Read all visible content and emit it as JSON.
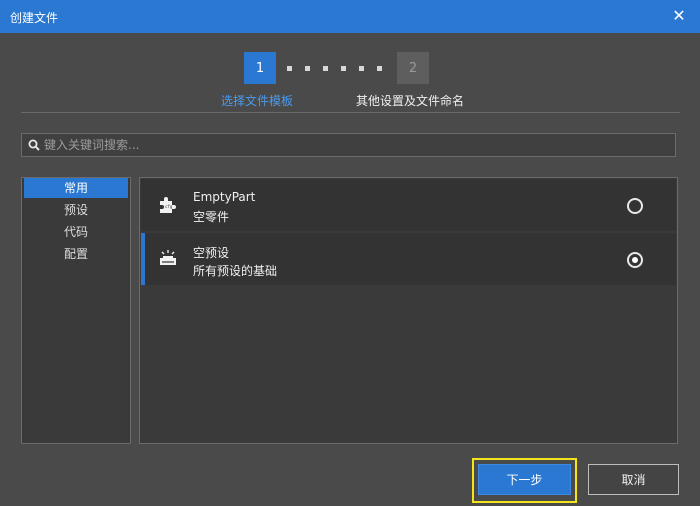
{
  "window": {
    "title": "创建文件",
    "close_icon": "close-icon"
  },
  "stepper": {
    "steps": [
      {
        "number": "1",
        "label": "选择文件模板",
        "state": "active"
      },
      {
        "number": "2",
        "label": "其他设置及文件命名",
        "state": "inactive"
      }
    ]
  },
  "search": {
    "placeholder": "键入关键词搜索...",
    "value": ""
  },
  "categories": [
    {
      "label": "常用",
      "active": true
    },
    {
      "label": "预设",
      "active": false
    },
    {
      "label": "代码",
      "active": false
    },
    {
      "label": "配置",
      "active": false
    }
  ],
  "templates": [
    {
      "name": "EmptyPart",
      "description": "空零件",
      "icon": "puzzle-icon",
      "selected": false
    },
    {
      "name": "空预设",
      "description": "所有预设的基础",
      "icon": "preset-icon",
      "selected": true
    }
  ],
  "buttons": {
    "next": "下一步",
    "cancel": "取消"
  },
  "colors": {
    "accent": "#2a78d2",
    "highlight": "#f2e51a",
    "background": "#4a4a4a"
  }
}
